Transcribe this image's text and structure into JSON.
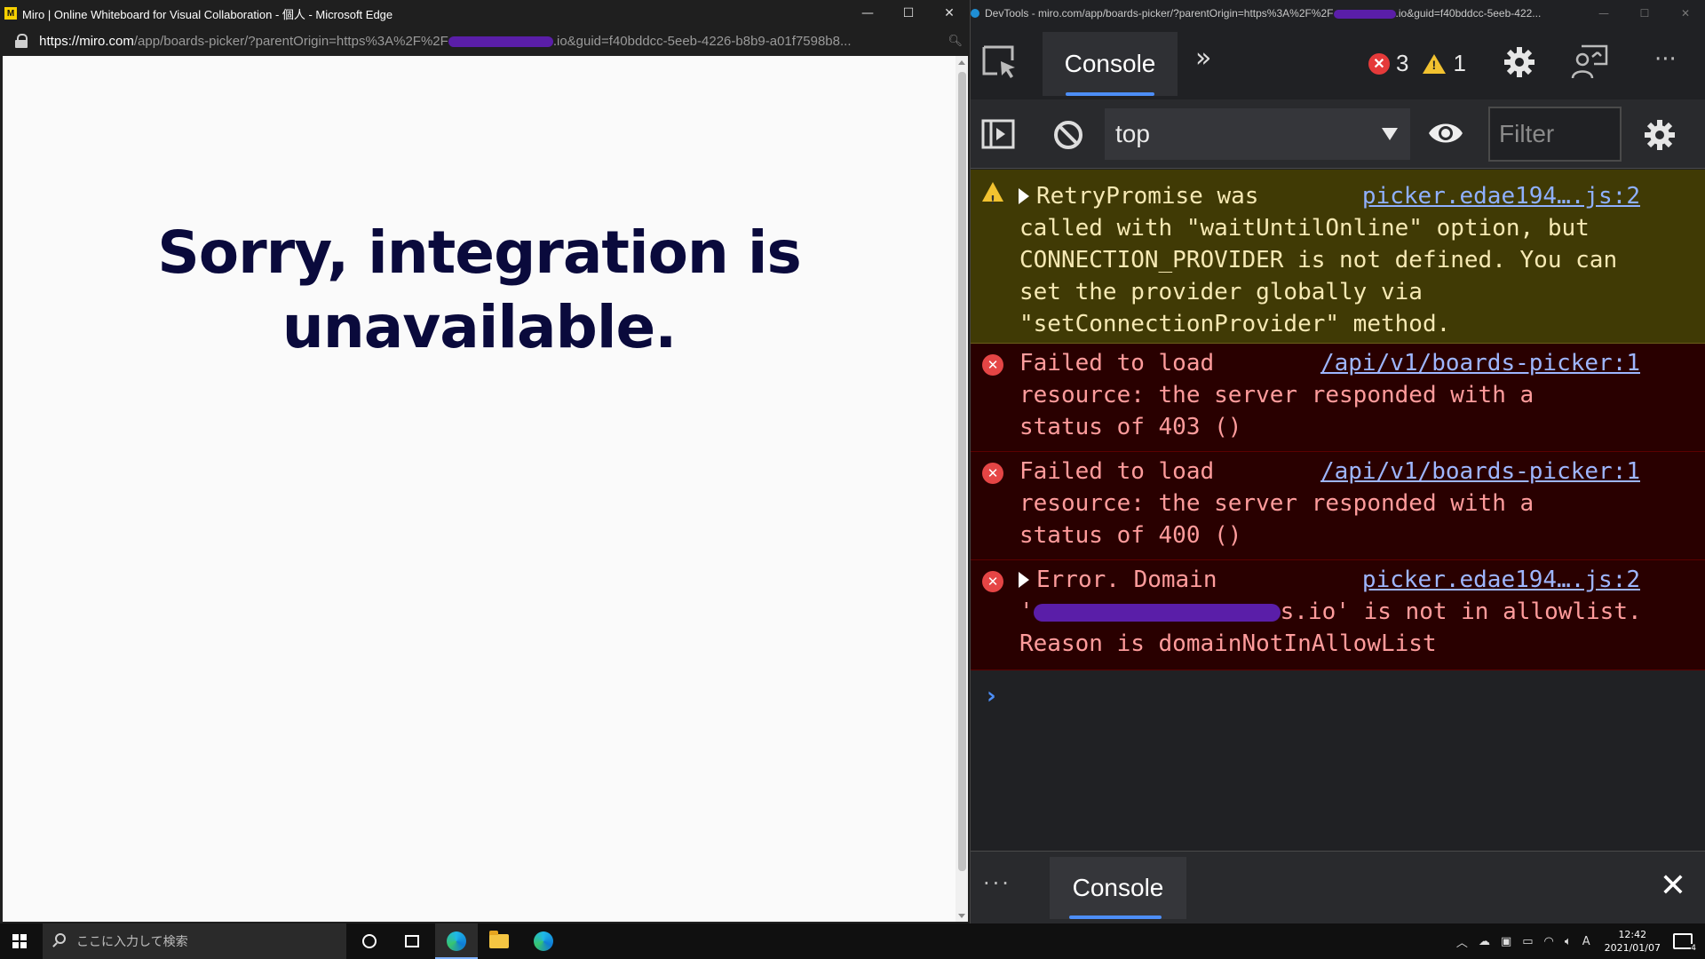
{
  "edge": {
    "title": "Miro | Online Whiteboard for Visual Collaboration - 個人 - Microsoft Edge",
    "url_host": "https://miro.com",
    "url_path_a": "/app/boards-picker/?parentOrigin=https%3A%2F%2F",
    "url_path_b": ".io&guid=f40bddcc-5eeb-4226-b8b9-a01f7598b8...",
    "headline_line1": "Sorry, integration is",
    "headline_line2": "unavailable."
  },
  "devtools": {
    "title_a": "DevTools - miro.com/app/boards-picker/?parentOrigin=https%3A%2F%2F",
    "title_b": ".io&guid=f40bddcc-5eeb-422...",
    "tab_console": "Console",
    "error_count": "3",
    "warning_count": "1",
    "context": "top",
    "filter_placeholder": "Filter",
    "messages": [
      {
        "level": "warning",
        "source": "picker.edae194….js:2",
        "first": "RetryPromise was",
        "rest": "called with \"waitUntilOnline\" option, but\nCONNECTION_PROVIDER is not defined. You can\nset the provider globally via\n\"setConnectionProvider\" method."
      },
      {
        "level": "error",
        "source": "/api/v1/boards-picker:1",
        "first": "Failed to load",
        "rest": "resource: the server responded with a\nstatus of 403 ()"
      },
      {
        "level": "error",
        "source": "/api/v1/boards-picker:1",
        "first": "Failed to load",
        "rest": "resource: the server responded with a\nstatus of 400 ()"
      },
      {
        "level": "error",
        "source": "picker.edae194….js:2",
        "first": "Error. Domain",
        "rest_a": "'",
        "rest_b": "s.io' is not in allowlist.",
        "rest_c": "Reason is domainNotInAllowList"
      }
    ],
    "drawer_tab": "Console"
  },
  "taskbar": {
    "search_placeholder": "ここに入力して検索",
    "time": "12:42",
    "date": "2021/01/07",
    "ime": "A",
    "notifications": "4"
  },
  "colors": {
    "headline": "#0a0a3c",
    "warning_bg": "#403a05",
    "error_bg": "#290000",
    "accent": "#4d8ef7"
  }
}
